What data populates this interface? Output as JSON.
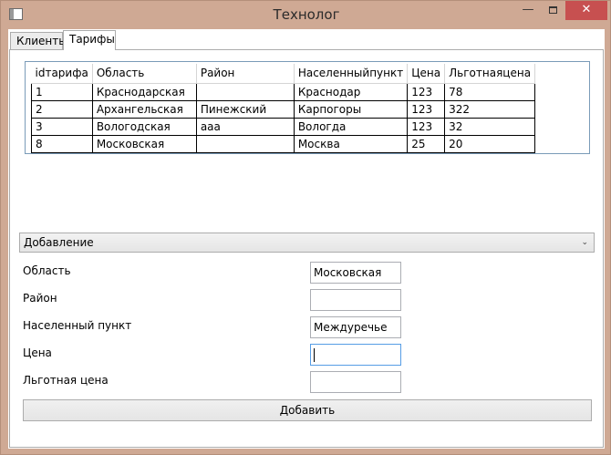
{
  "window": {
    "title": "Технолог",
    "close_glyph": "✕",
    "min_glyph": "—"
  },
  "tabs": [
    {
      "label": "Клиенты"
    },
    {
      "label": "Тарифы"
    }
  ],
  "grid": {
    "columns": [
      "idтарифа",
      "Область",
      "Район",
      "Населенныйпункт",
      "Цена",
      "Льготнаяцена"
    ],
    "rows": [
      [
        "1",
        "Краснодарская",
        "",
        "Краснодар",
        "123",
        "78"
      ],
      [
        "2",
        "Архангельская",
        "Пинежский",
        "Карпогоры",
        "123",
        "322"
      ],
      [
        "3",
        "Вологодская",
        "ааа",
        "Вологда",
        "123",
        "32"
      ],
      [
        "8",
        "Московская",
        "",
        "Москва",
        "25",
        "20"
      ]
    ]
  },
  "mode_combo": {
    "selected": "Добавление",
    "arrow": "⌄"
  },
  "form": {
    "oblast": {
      "label": "Область",
      "value": "Московская"
    },
    "rayon": {
      "label": "Район",
      "value": ""
    },
    "punkt": {
      "label": "Населенный пункт",
      "value": "Междуречье"
    },
    "price": {
      "label": "Цена",
      "value": ""
    },
    "discount_price": {
      "label": "Льготная цена",
      "value": ""
    }
  },
  "add_button": {
    "label": "Добавить"
  }
}
